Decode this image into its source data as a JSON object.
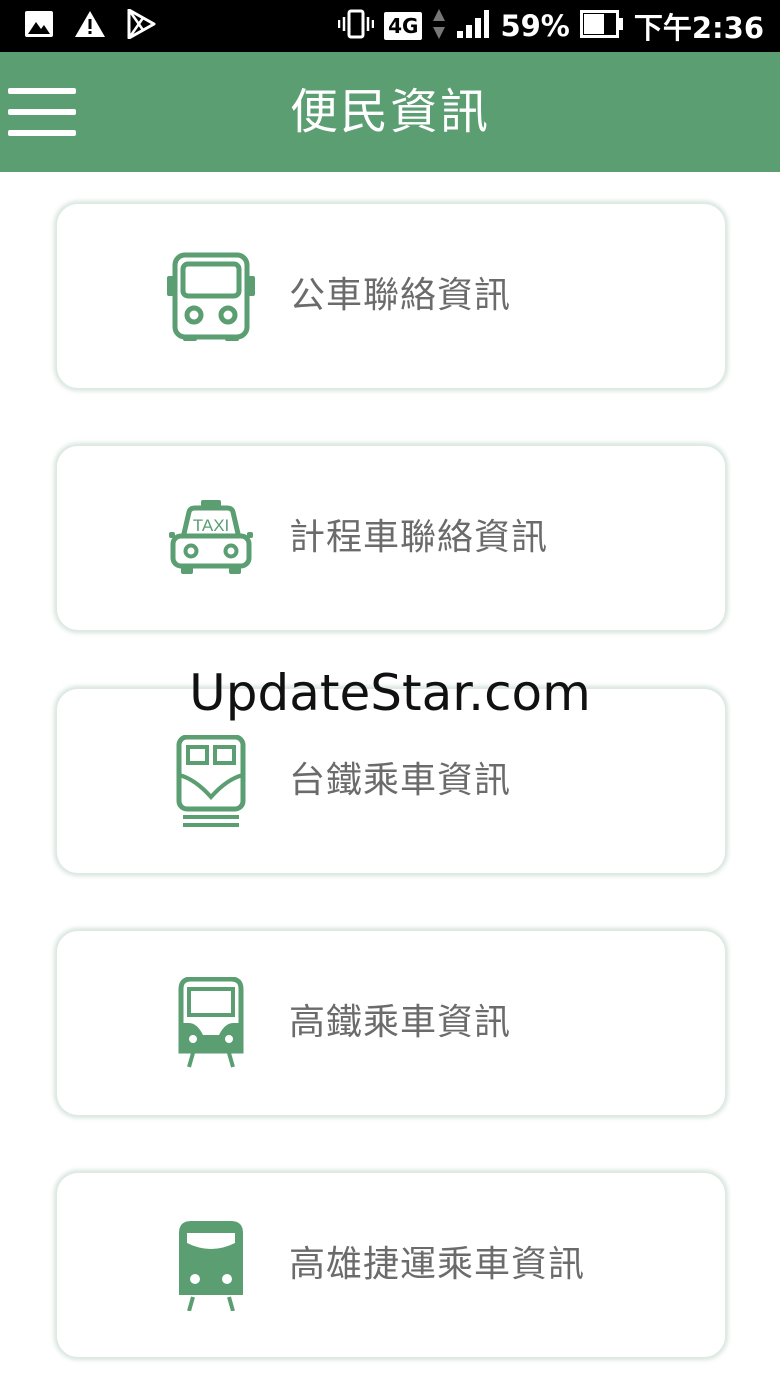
{
  "status_bar": {
    "network": "4G",
    "battery": "59%",
    "time": "下午2:36"
  },
  "header": {
    "title": "便民資訊"
  },
  "cards": [
    {
      "label": "公車聯絡資訊",
      "icon": "bus-icon"
    },
    {
      "label": "計程車聯絡資訊",
      "icon": "taxi-icon",
      "icon_text": "TAXI"
    },
    {
      "label": "台鐵乘車資訊",
      "icon": "train-icon"
    },
    {
      "label": "高鐵乘車資訊",
      "icon": "high-speed-rail-icon"
    },
    {
      "label": "高雄捷運乘車資訊",
      "icon": "metro-icon"
    }
  ],
  "watermark": "UpdateStar.com",
  "colors": {
    "accent": "#5a9e72",
    "card_text": "#6b6b6b"
  }
}
